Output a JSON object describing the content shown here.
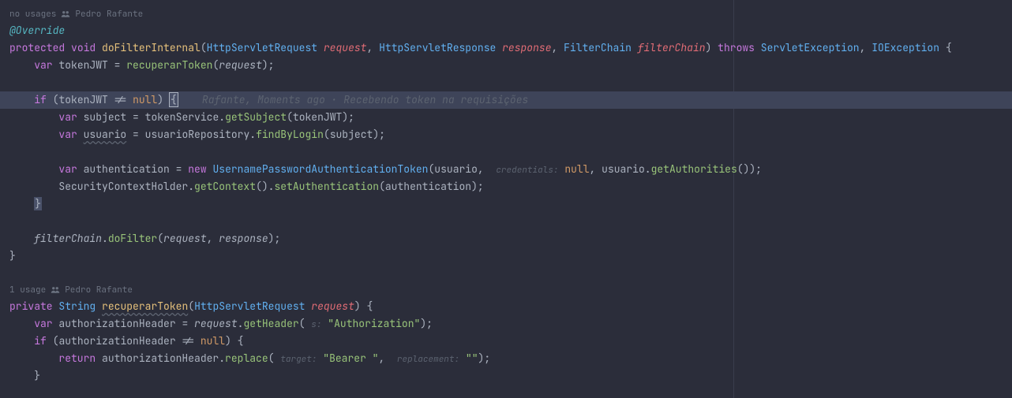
{
  "usage1": {
    "text": "no usages",
    "author": "Pedro Rafante"
  },
  "usage2": {
    "text": "1 usage",
    "author": "Pedro Rafante"
  },
  "m1": {
    "annotation": "@Override",
    "kw_protected": "protected",
    "kw_void": "void",
    "name": "doFilterInternal",
    "p1t": "HttpServletRequest",
    "p1n": "request",
    "p2t": "HttpServletResponse",
    "p2n": "response",
    "p3t": "FilterChain",
    "p3n": "filterChain",
    "kw_throws": "throws",
    "ex1": "ServletException",
    "ex2": "IOException",
    "l1": {
      "kw": "var",
      "name": "tokenJWT",
      "call": "recuperarToken",
      "arg": "request"
    },
    "l2": {
      "kw": "if",
      "name": "tokenJWT",
      "null": "null",
      "comment": "Rafante, Moments ago · Recebendo token na requisições"
    },
    "l3": {
      "kw": "var",
      "name": "subject",
      "obj": "tokenService",
      "call": "getSubject",
      "arg": "tokenJWT"
    },
    "l4": {
      "kw": "var",
      "name": "usuario",
      "obj": "usuarioRepository",
      "call": "findByLogin",
      "arg": "subject"
    },
    "l5": {
      "kw": "var",
      "name": "authentication",
      "new": "new",
      "cls": "UsernamePasswordAuthenticationToken",
      "a1": "usuario",
      "hint": "credentials:",
      "null": "null",
      "a3": "usuario",
      "call": "getAuthorities"
    },
    "l6": {
      "obj": "SecurityContextHolder",
      "c1": "getContext",
      "c2": "setAuthentication",
      "arg": "authentication"
    },
    "l7": {
      "obj": "filterChain",
      "call": "doFilter",
      "a1": "request",
      "a2": "response"
    }
  },
  "m2": {
    "kw_private": "private",
    "ret": "String",
    "name": "recuperarToken",
    "p1t": "HttpServletRequest",
    "p1n": "request",
    "l1": {
      "kw": "var",
      "name": "authorizationHeader",
      "obj": "request",
      "call": "getHeader",
      "hint": "s:",
      "str": "\"Authorization\""
    },
    "l2": {
      "kw": "if",
      "name": "authorizationHeader",
      "null": "null"
    },
    "l3": {
      "kw": "return",
      "obj": "authorizationHeader",
      "call": "replace",
      "h1": "target:",
      "s1": "\"Bearer \"",
      "h2": "replacement:",
      "s2": "\"\""
    }
  }
}
